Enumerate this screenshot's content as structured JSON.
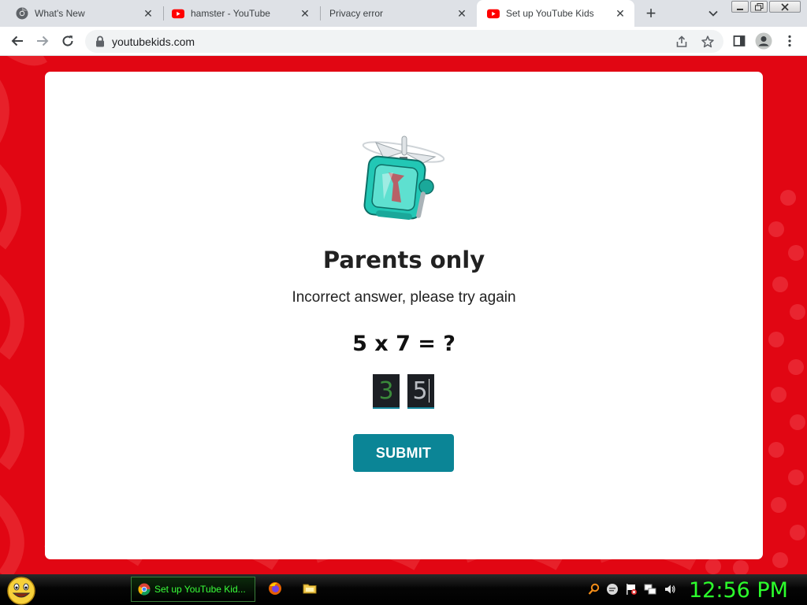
{
  "browser": {
    "tabs": [
      {
        "title": "What's New",
        "icon": "chrome-icon",
        "active": false
      },
      {
        "title": "hamster - YouTube",
        "icon": "youtube-icon",
        "active": false
      },
      {
        "title": "Privacy error",
        "icon": "none",
        "active": false
      },
      {
        "title": "Set up YouTube Kids",
        "icon": "youtube-icon",
        "active": true
      }
    ],
    "url": "youtubekids.com"
  },
  "page": {
    "heading": "Parents only",
    "message": "Incorrect answer, please try again",
    "question": "5 x 7 = ?",
    "answer_digits": [
      "3",
      "5"
    ],
    "submit_label": "SUBMIT",
    "colors": {
      "background": "#e10613",
      "button": "#0b8596"
    }
  },
  "taskbar": {
    "task_label": "Set up YouTube Kid...",
    "clock": "12:56 PM"
  }
}
